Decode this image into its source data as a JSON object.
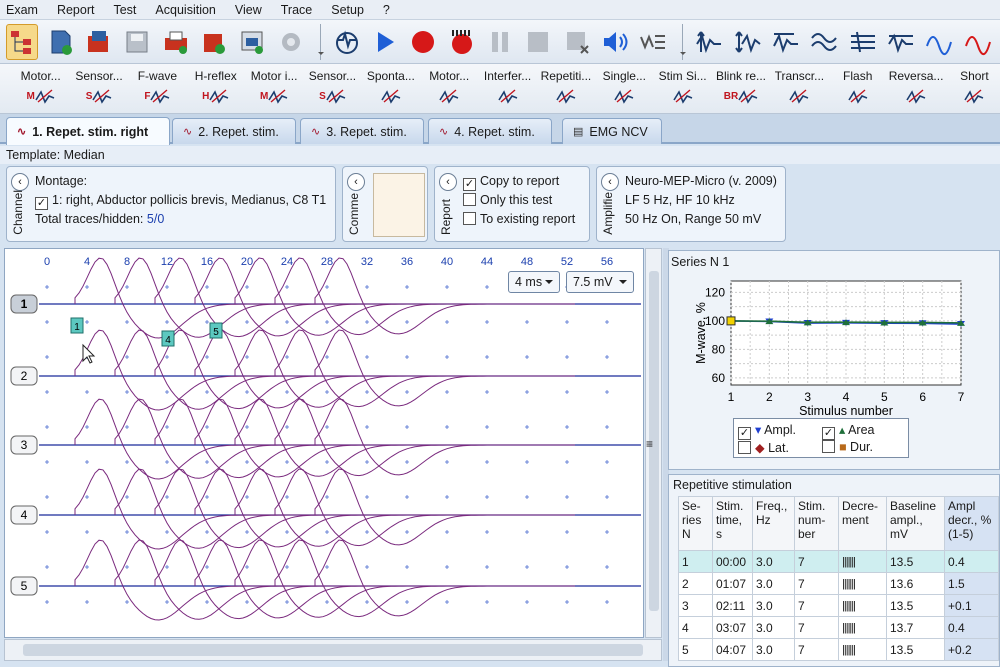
{
  "menu": [
    "Exam",
    "Report",
    "Test",
    "Acquisition",
    "View",
    "Trace",
    "Setup",
    "?"
  ],
  "test_tools": [
    {
      "label": "Motor...",
      "icon": "M"
    },
    {
      "label": "Sensor...",
      "icon": "S"
    },
    {
      "label": "F-wave",
      "icon": "F"
    },
    {
      "label": "H-reflex",
      "icon": "H"
    },
    {
      "label": "Motor i...",
      "icon": "M"
    },
    {
      "label": "Sensor...",
      "icon": "S"
    },
    {
      "label": "Sponta...",
      "icon": ""
    },
    {
      "label": "Motor...",
      "icon": ""
    },
    {
      "label": "Interfer...",
      "icon": ""
    },
    {
      "label": "Repetiti...",
      "icon": ""
    },
    {
      "label": "Single...",
      "icon": ""
    },
    {
      "label": "Stim Si...",
      "icon": ""
    },
    {
      "label": "Blink re...",
      "icon": "BR"
    },
    {
      "label": "Transcr...",
      "icon": ""
    },
    {
      "label": "Flash",
      "icon": ""
    },
    {
      "label": "Reversa...",
      "icon": ""
    },
    {
      "label": "Short",
      "icon": ""
    }
  ],
  "tabs": [
    "1. Repet. stim. right",
    "2. Repet. stim.",
    "3. Repet. stim.",
    "4. Repet. stim.",
    "EMG NCV"
  ],
  "template": "Template: Median",
  "montage": {
    "title": "Montage:",
    "channel": "1: right, Abductor pollicis brevis, Medianus, C8 T1",
    "traces_label": "Total traces/hidden:",
    "traces_value": "5/0",
    "side_label": "Channel"
  },
  "comment": {
    "side_label": "Comme"
  },
  "report": {
    "side_label": "Report",
    "options": [
      {
        "label": "Copy to report",
        "checked": true
      },
      {
        "label": "Only this test",
        "checked": false
      },
      {
        "label": "To existing report",
        "checked": false
      }
    ]
  },
  "amplifier": {
    "side_label": "Amplifie",
    "lines": [
      "Neuro-MEP-Micro (v. 2009)",
      "LF  5 Hz, HF  10 kHz",
      "50 Hz  On, Range  50 mV"
    ]
  },
  "waveform": {
    "time_ticks": [
      "0",
      "4",
      "8",
      "12",
      "16",
      "20",
      "24",
      "28",
      "32",
      "36",
      "40",
      "44",
      "48",
      "52",
      "56"
    ],
    "sweep": "4 ms",
    "sensitivity": "7.5 mV",
    "trace_labels": [
      "1",
      "2",
      "3",
      "4",
      "5"
    ],
    "markers": [
      "1",
      "4",
      "5"
    ]
  },
  "series_panel": {
    "title": "Series N 1"
  },
  "chart_data": {
    "type": "line",
    "title": "",
    "xlabel": "Stimulus number",
    "ylabel": "M-wave, %",
    "x": [
      1,
      2,
      3,
      4,
      5,
      6,
      7
    ],
    "xlim": [
      1,
      7
    ],
    "ylim": [
      55,
      128
    ],
    "yticks": [
      60,
      80,
      100,
      120
    ],
    "grid": true,
    "series": [
      {
        "name": "Ampl.",
        "values": [
          100,
          99.6,
          98.5,
          98.6,
          98.4,
          98.3,
          97.8
        ],
        "color": "#1f3fd0"
      },
      {
        "name": "Area",
        "values": [
          100,
          99.8,
          99.0,
          99.1,
          98.9,
          98.9,
          98.6
        ],
        "color": "#1f6f3a"
      }
    ],
    "legend": [
      {
        "name": "Ampl.",
        "checked": true
      },
      {
        "name": "Area",
        "checked": true
      },
      {
        "name": "Lat.",
        "checked": false
      },
      {
        "name": "Dur.",
        "checked": false
      }
    ]
  },
  "repetitive": {
    "title": "Repetitive stimulation",
    "headers": [
      "Se-ries N",
      "Stim. time, s",
      "Freq., Hz",
      "Stim. num-ber",
      "Decre-ment",
      "Baseline ampl., mV",
      "Ampl decr., % (1-5)"
    ],
    "rows": [
      [
        "1",
        "00:00",
        "3.0",
        "7",
        "|||||||",
        "13.5",
        "0.4"
      ],
      [
        "2",
        "01:07",
        "3.0",
        "7",
        "|||||||",
        "13.6",
        "1.5"
      ],
      [
        "3",
        "02:11",
        "3.0",
        "7",
        "|||||||",
        "13.5",
        "+0.1"
      ],
      [
        "4",
        "03:07",
        "3.0",
        "7",
        "|||||||",
        "13.7",
        "0.4"
      ],
      [
        "5",
        "04:07",
        "3.0",
        "7",
        "|||||||",
        "13.5",
        "+0.2"
      ]
    ]
  }
}
